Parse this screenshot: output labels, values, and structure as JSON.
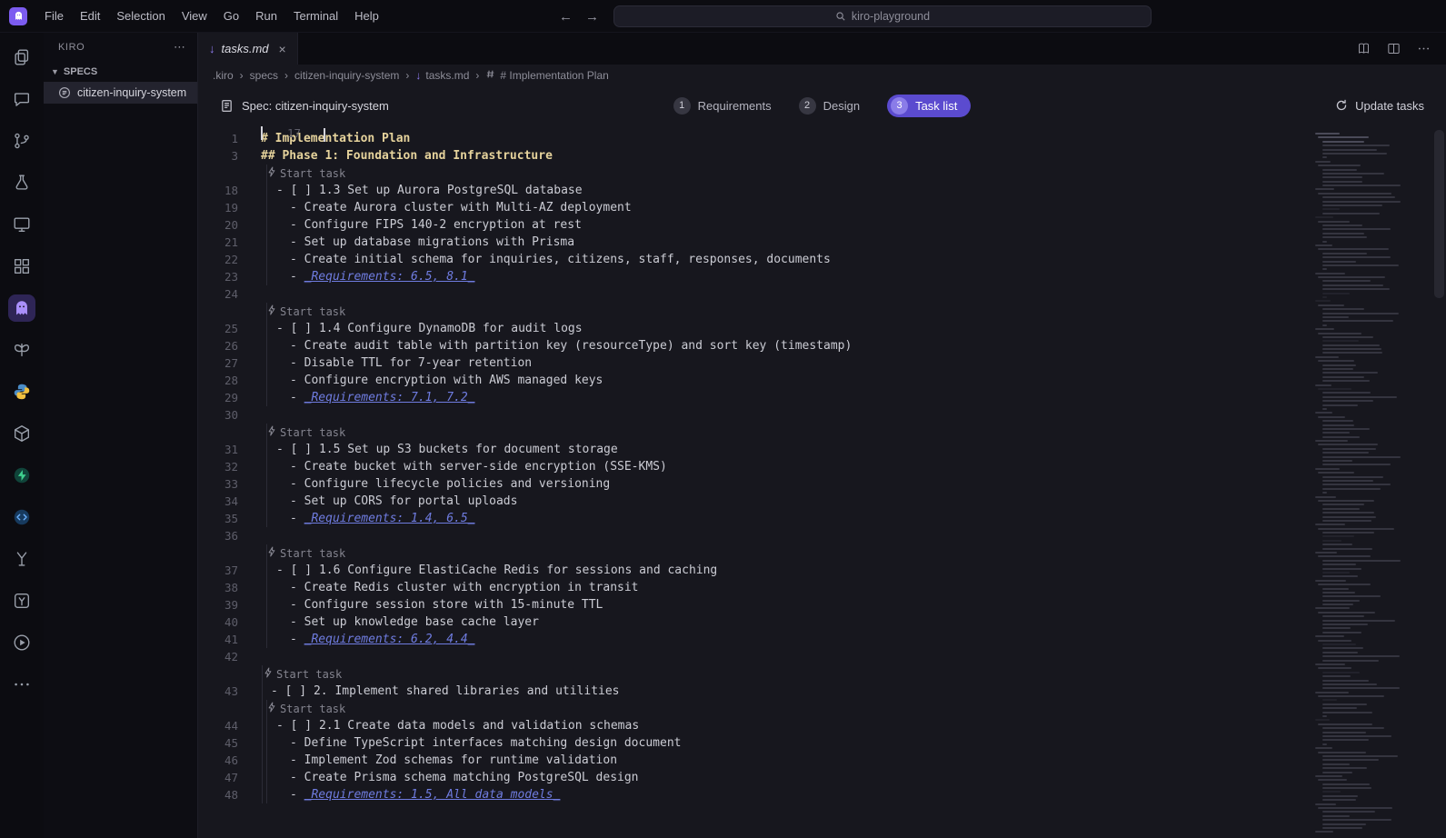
{
  "titlebar": {
    "menus": [
      "File",
      "Edit",
      "Selection",
      "View",
      "Go",
      "Run",
      "Terminal",
      "Help"
    ],
    "search": "kiro-playground"
  },
  "activity_bar": {
    "items": [
      {
        "id": "explorer"
      },
      {
        "id": "chat"
      },
      {
        "id": "source-control"
      },
      {
        "id": "debug-flask"
      },
      {
        "id": "preview"
      },
      {
        "id": "extensions"
      },
      {
        "id": "kiro",
        "active": true
      },
      {
        "id": "butterfly"
      },
      {
        "id": "python"
      },
      {
        "id": "package"
      },
      {
        "id": "supabase"
      },
      {
        "id": "code-runner"
      },
      {
        "id": "test-1"
      },
      {
        "id": "test-2"
      },
      {
        "id": "run"
      },
      {
        "id": "more"
      }
    ]
  },
  "sidebar": {
    "title": "KIRO",
    "section": "SPECS",
    "items": [
      {
        "label": "citizen-inquiry-system",
        "selected": true
      }
    ]
  },
  "tabbar": {
    "tabs": [
      {
        "label": "tasks.md",
        "active": true
      }
    ]
  },
  "breadcrumb": {
    "separator": "›",
    "items": [
      {
        "label": ".kiro"
      },
      {
        "label": "specs"
      },
      {
        "label": "citizen-inquiry-system"
      },
      {
        "label": "tasks.md",
        "icon": "markdown"
      },
      {
        "label": "# Implementation Plan",
        "icon": "symbol"
      }
    ]
  },
  "specbar": {
    "label": "Spec: citizen-inquiry-system",
    "steps": [
      {
        "num": "1",
        "label": "Requirements",
        "active": false
      },
      {
        "num": "2",
        "label": "Design",
        "active": false
      },
      {
        "num": "3",
        "label": "Task list",
        "active": true
      }
    ],
    "update_label": "Update tasks"
  },
  "editor": {
    "lens_label": "Start task",
    "rows": [
      {
        "n": "1",
        "t": "h",
        "c": "# Implementation Plan"
      },
      {
        "n": "3",
        "t": "h",
        "c": "## Phase 1: Foundation and Infrastructure"
      },
      {
        "n": "17",
        "t": "cursor",
        "c": ""
      },
      {
        "t": "lens",
        "lvl": 2,
        "g2": true
      },
      {
        "n": "18",
        "t": "task",
        "lvl": 2,
        "g2": true,
        "c": "- [ ] 1.3 Set up Aurora PostgreSQL database"
      },
      {
        "n": "19",
        "t": "sub",
        "g2": true,
        "c": "- Create Aurora cluster with Multi-AZ deployment"
      },
      {
        "n": "20",
        "t": "sub",
        "g2": true,
        "c": "- Configure FIPS 140-2 encryption at rest"
      },
      {
        "n": "21",
        "t": "sub",
        "g2": true,
        "c": "- Set up database migrations with Prisma"
      },
      {
        "n": "22",
        "t": "sub",
        "g2": true,
        "c": "- Create initial schema for inquiries, citizens, staff, responses, documents"
      },
      {
        "n": "23",
        "t": "req",
        "g2": true,
        "pre": "- ",
        "c": "_Requirements: 6.5, 8.1_"
      },
      {
        "n": "24",
        "t": "blank"
      },
      {
        "t": "lens",
        "lvl": 2,
        "g2": true
      },
      {
        "n": "25",
        "t": "task",
        "lvl": 2,
        "g2": true,
        "c": "- [ ] 1.4 Configure DynamoDB for audit logs"
      },
      {
        "n": "26",
        "t": "sub",
        "g2": true,
        "c": "- Create audit table with partition key (resourceType) and sort key (timestamp)"
      },
      {
        "n": "27",
        "t": "sub",
        "g2": true,
        "c": "- Disable TTL for 7-year retention"
      },
      {
        "n": "28",
        "t": "sub",
        "g2": true,
        "c": "- Configure encryption with AWS managed keys"
      },
      {
        "n": "29",
        "t": "req",
        "g2": true,
        "pre": "- ",
        "c": "_Requirements: 7.1, 7.2_"
      },
      {
        "n": "30",
        "t": "blank"
      },
      {
        "t": "lens",
        "lvl": 2,
        "g2": true
      },
      {
        "n": "31",
        "t": "task",
        "lvl": 2,
        "g2": true,
        "c": "- [ ] 1.5 Set up S3 buckets for document storage"
      },
      {
        "n": "32",
        "t": "sub",
        "g2": true,
        "c": "- Create bucket with server-side encryption (SSE-KMS)"
      },
      {
        "n": "33",
        "t": "sub",
        "g2": true,
        "c": "- Configure lifecycle policies and versioning"
      },
      {
        "n": "34",
        "t": "sub",
        "g2": true,
        "c": "- Set up CORS for portal uploads"
      },
      {
        "n": "35",
        "t": "req",
        "g2": true,
        "pre": "- ",
        "c": "_Requirements: 1.4, 6.5_"
      },
      {
        "n": "36",
        "t": "blank"
      },
      {
        "t": "lens",
        "lvl": 2,
        "g2": true
      },
      {
        "n": "37",
        "t": "task",
        "lvl": 2,
        "g2": true,
        "c": "- [ ] 1.6 Configure ElastiCache Redis for sessions and caching"
      },
      {
        "n": "38",
        "t": "sub",
        "g2": true,
        "c": "- Create Redis cluster with encryption in transit"
      },
      {
        "n": "39",
        "t": "sub",
        "g2": true,
        "c": "- Configure session store with 15-minute TTL"
      },
      {
        "n": "40",
        "t": "sub",
        "g2": true,
        "c": "- Set up knowledge base cache layer"
      },
      {
        "n": "41",
        "t": "req",
        "g2": true,
        "pre": "- ",
        "c": "_Requirements: 6.2, 4.4_"
      },
      {
        "n": "42",
        "t": "blank"
      },
      {
        "t": "lens",
        "lvl": 1,
        "g1": true
      },
      {
        "n": "43",
        "t": "task",
        "lvl": 1,
        "g1": true,
        "c": "- [ ] 2. Implement shared libraries and utilities"
      },
      {
        "t": "lens",
        "lvl": 2,
        "g1": true,
        "g2": true
      },
      {
        "n": "44",
        "t": "task",
        "lvl": 2,
        "g1": true,
        "g2": true,
        "c": "- [ ] 2.1 Create data models and validation schemas"
      },
      {
        "n": "45",
        "t": "sub",
        "g1": true,
        "g2": true,
        "c": "- Define TypeScript interfaces matching design document"
      },
      {
        "n": "46",
        "t": "sub",
        "g1": true,
        "g2": true,
        "c": "- Implement Zod schemas for runtime validation"
      },
      {
        "n": "47",
        "t": "sub",
        "g1": true,
        "g2": true,
        "c": "- Create Prisma schema matching PostgreSQL design"
      },
      {
        "n": "48",
        "t": "req",
        "g1": true,
        "g2": true,
        "pre": "- ",
        "c": "_Requirements: 1.5, All data models_"
      }
    ]
  },
  "colors": {
    "accent_purple": "#5b4bcf",
    "kiro_purple": "#a98ffb",
    "heading_text": "#e6d39c",
    "requirements_link": "#6f7ce0",
    "editor_bg": "#17171e",
    "chrome_bg": "#0c0c11",
    "supabase_green": "#3ecf8e",
    "python_blue": "#4a8cc7",
    "python_yellow": "#f0c040"
  }
}
